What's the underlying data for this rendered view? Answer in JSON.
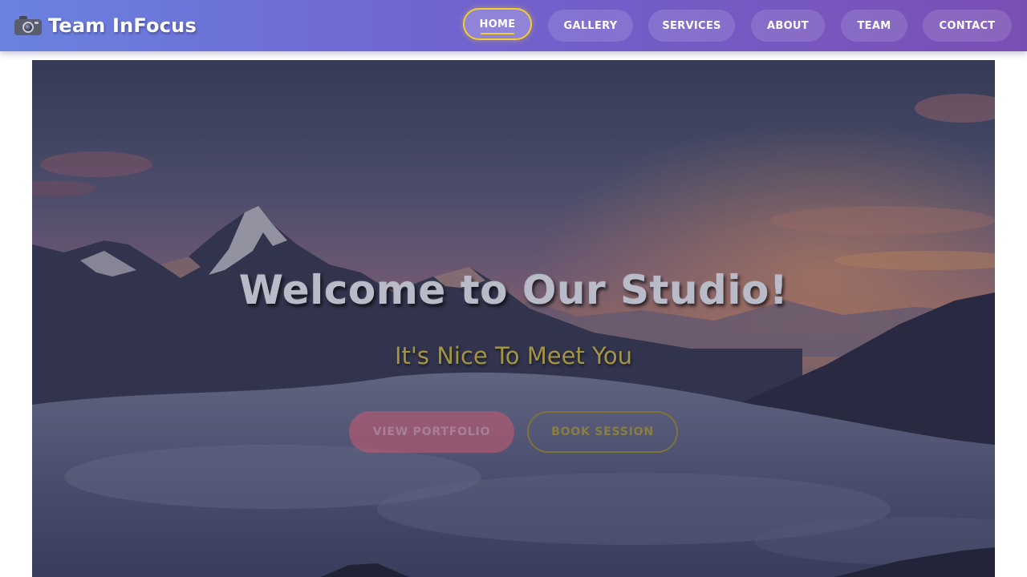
{
  "brand": {
    "icon": "camera-icon",
    "name": "Team InFocus"
  },
  "nav": {
    "items": [
      {
        "label": "HOME",
        "active": true
      },
      {
        "label": "GALLERY",
        "active": false
      },
      {
        "label": "SERVICES",
        "active": false
      },
      {
        "label": "ABOUT",
        "active": false
      },
      {
        "label": "TEAM",
        "active": false
      },
      {
        "label": "CONTACT",
        "active": false
      }
    ]
  },
  "hero": {
    "title": "Welcome to Our Studio!",
    "subtitle": "It's Nice To Meet You",
    "buttons": {
      "portfolio": "VIEW PORTFOLIO",
      "book": "BOOK SESSION"
    }
  },
  "colors": {
    "nav_gradient_start": "#6a82e0",
    "nav_gradient_end": "#7a4fb4",
    "active_accent": "#f2cf2d",
    "subtitle": "#a39545",
    "portfolio_button": "#be5a73"
  }
}
